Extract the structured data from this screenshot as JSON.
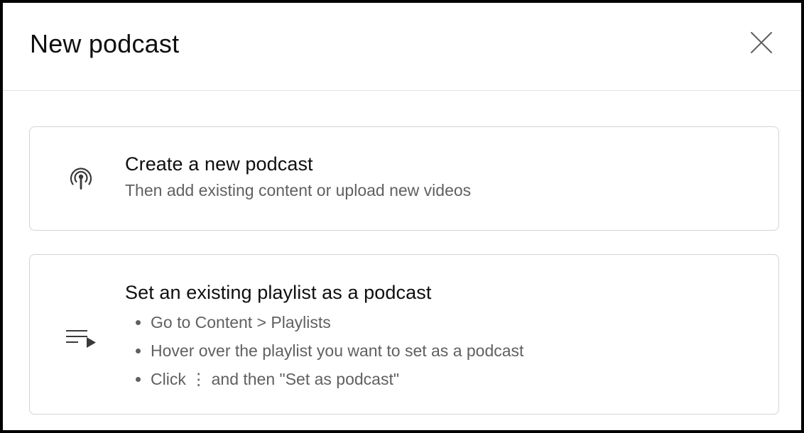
{
  "dialog": {
    "title": "New podcast",
    "close_icon": "close-icon"
  },
  "options": {
    "create": {
      "icon": "podcast-icon",
      "title": "Create a new podcast",
      "subtitle": "Then add existing content or upload new videos"
    },
    "playlist": {
      "icon": "playlist-play-icon",
      "title": "Set an existing playlist as a podcast",
      "steps": [
        "Go to Content > Playlists",
        "Hover over the playlist you want to set as a podcast",
        "Click ⋮ and then \"Set as podcast\""
      ]
    }
  }
}
